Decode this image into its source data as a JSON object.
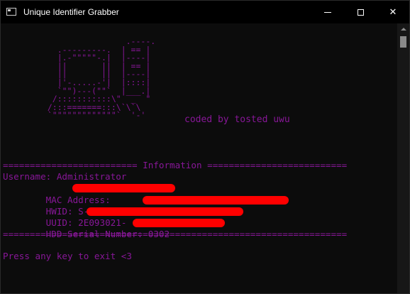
{
  "window": {
    "title": "Unique Identifier Grabber",
    "controls": {
      "minimize": "minimize",
      "maximize": "maximize",
      "close": "✕"
    }
  },
  "console": {
    "ascii_art": "                  .----.\n    .---------.  | == |\n    |.-\"\"\"\"\"-.|  |----|\n    ||       ||  | == |\n    ||       ||  |----|\n    |'-.....-'|  |::::|\n    `\"\")---(\"\"`  |___.|\n   /:::::::::::\\\"  _  \"\n  /:::=======:::\\`\\`\\\n  `\"\"\"\"\"\"\"\"\"\"\"\"\"`  '-'",
    "tagline": "coded by tosted uwu",
    "info_header": "========================= Information ==========================",
    "username_line": "Username: Administrator",
    "mac_line": "MAC Address:",
    "hwid_line": "HWID: S-1-5-21-806196452-",
    "uuid_line": "UUID: 2E093021-",
    "hdd_line": "HDD Serial Number: 0302",
    "footer_rule": "================================================================",
    "exit_prompt": "Press any key to exit <3"
  },
  "colors": {
    "console_text": "#881798",
    "background": "#0c0c0c",
    "redaction": "#ff0000"
  },
  "icons": {
    "app": "console-window-icon",
    "minimize": "minimize-icon",
    "maximize": "maximize-icon",
    "close": "close-icon"
  }
}
